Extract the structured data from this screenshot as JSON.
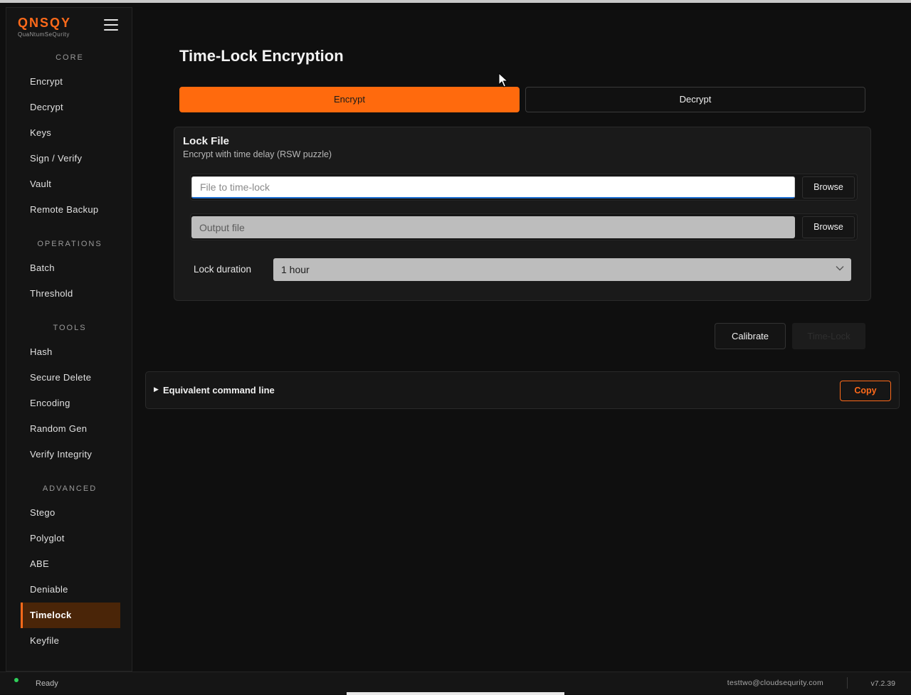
{
  "app": {
    "logo_main": "QNSQY",
    "logo_sub": "QuaNtumSeQurity"
  },
  "sidebar": {
    "sections": [
      {
        "title": "CORE",
        "items": [
          "Encrypt",
          "Decrypt",
          "Keys",
          "Sign / Verify",
          "Vault",
          "Remote Backup"
        ]
      },
      {
        "title": "OPERATIONS",
        "items": [
          "Batch",
          "Threshold"
        ]
      },
      {
        "title": "TOOLS",
        "items": [
          "Hash",
          "Secure Delete",
          "Encoding",
          "Random Gen",
          "Verify Integrity"
        ]
      },
      {
        "title": "ADVANCED",
        "items": [
          "Stego",
          "Polyglot",
          "ABE",
          "Deniable",
          "Timelock",
          "Keyfile"
        ]
      }
    ],
    "active_item": "Timelock"
  },
  "main": {
    "title": "Time-Lock Encryption",
    "tabs": [
      {
        "label": "Encrypt",
        "active": true
      },
      {
        "label": "Decrypt",
        "active": false
      }
    ],
    "card": {
      "title": "Lock File",
      "subtitle": "Encrypt with time delay (RSW puzzle)",
      "input_file": {
        "value": "",
        "placeholder": "File to time-lock",
        "browse_label": "Browse"
      },
      "output_file": {
        "value": "",
        "placeholder": "Output file",
        "browse_label": "Browse"
      },
      "lock_duration": {
        "label": "Lock duration",
        "selected": "1 hour"
      }
    },
    "actions": {
      "calibrate_label": "Calibrate",
      "timelock_label": "Time-Lock"
    },
    "command_line": {
      "title": "Equivalent command line",
      "copy_label": "Copy"
    }
  },
  "statusbar": {
    "status": "Ready",
    "user": "testtwo@cloudsequrity.com",
    "version": "v7.2.39"
  },
  "colors": {
    "accent": "#ff6a0d",
    "background": "#0f0f0f",
    "active_nav_bg": "#4a2508",
    "status_ok": "#2fd05a"
  },
  "icons": {
    "menu": "hamburger-icon",
    "dropdown": "chevron-down-icon",
    "expander": "triangle-right-icon"
  }
}
